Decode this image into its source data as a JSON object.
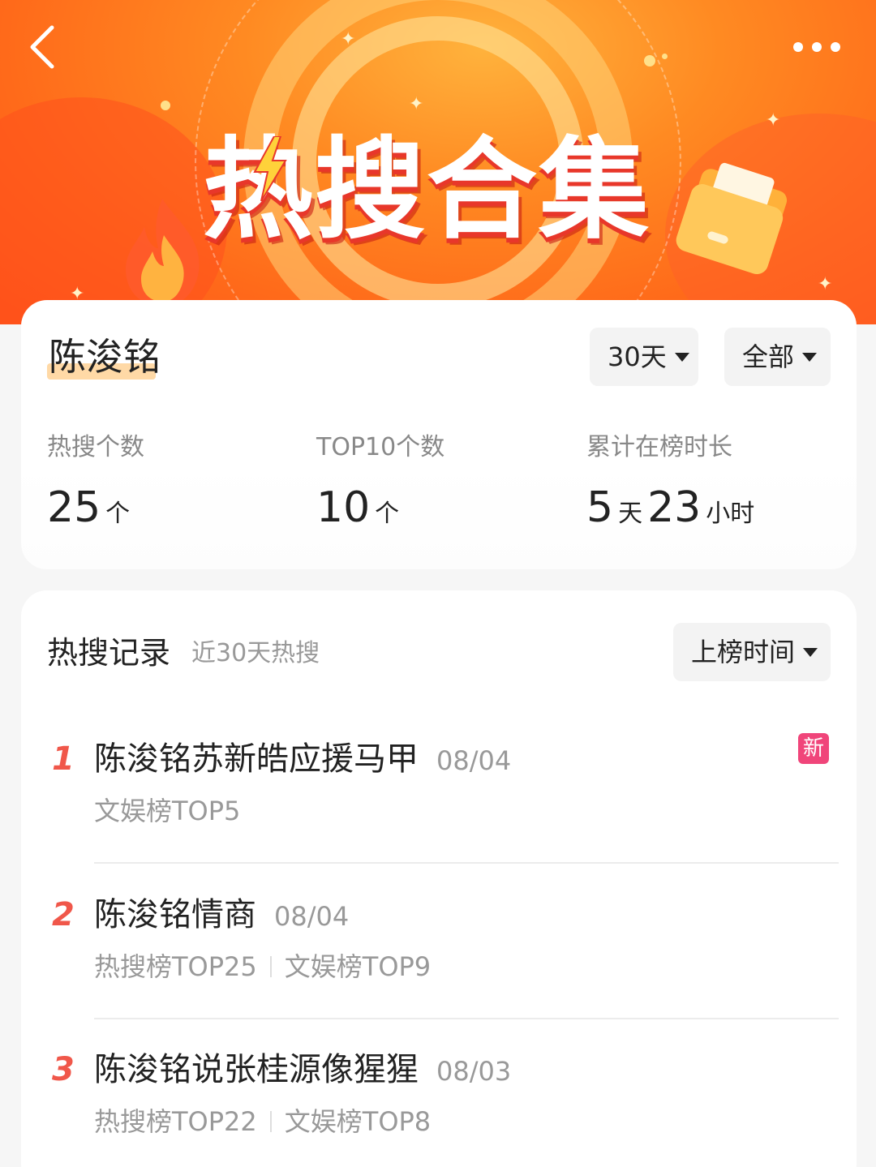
{
  "banner": {
    "title": "热搜合集",
    "back_icon": "chevron-left-icon",
    "more_icon": "more-horizontal-icon"
  },
  "profile": {
    "name": "陈浚铭",
    "filter_days": "30天",
    "filter_scope": "全部"
  },
  "stats": [
    {
      "label": "热搜个数",
      "value": "25",
      "unit": "个"
    },
    {
      "label": "TOP10个数",
      "value": "10",
      "unit": "个"
    },
    {
      "label": "累计在榜时长",
      "days": "5",
      "days_unit": "天",
      "hours": "23",
      "hours_unit": "小时"
    }
  ],
  "records": {
    "title": "热搜记录",
    "subtitle": "近30天热搜",
    "sort_label": "上榜时间",
    "items": [
      {
        "rank": "1",
        "title": "陈浚铭苏新皓应援马甲",
        "date": "08/04",
        "tags": [
          "文娱榜TOP5"
        ],
        "badge": "新"
      },
      {
        "rank": "2",
        "title": "陈浚铭情商",
        "date": "08/04",
        "tags": [
          "热搜榜TOP25",
          "文娱榜TOP9"
        ]
      },
      {
        "rank": "3",
        "title": "陈浚铭说张桂源像猩猩",
        "date": "08/03",
        "tags": [
          "热搜榜TOP22",
          "文娱榜TOP8"
        ]
      }
    ]
  },
  "colors": {
    "banner_orange": "#ff7a20",
    "rank_red": "#f0574a",
    "badge_pink": "#f0457a",
    "name_highlight": "#ffd9a6"
  }
}
